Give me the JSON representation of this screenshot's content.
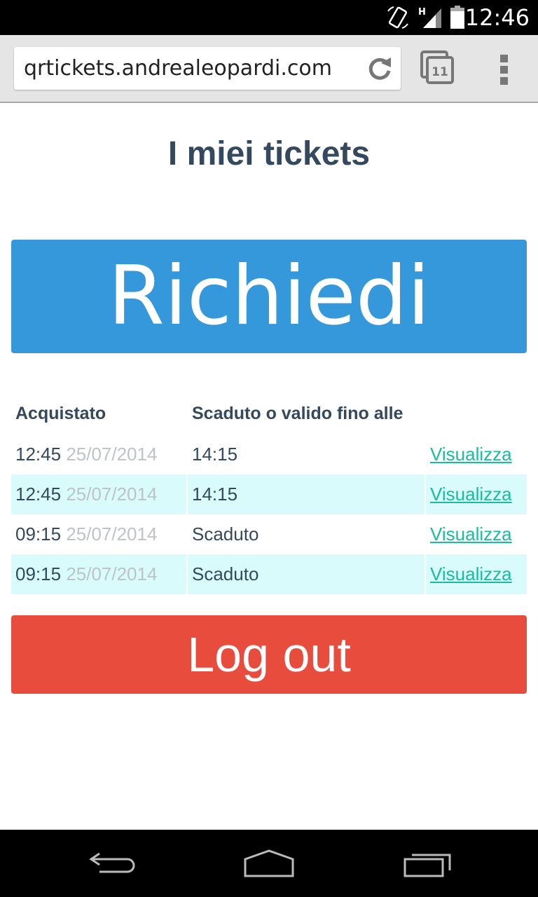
{
  "status_bar": {
    "time": "12:46",
    "icons": [
      "rotate-icon",
      "signal-h-icon",
      "battery-icon"
    ]
  },
  "browser": {
    "url": "qrtickets.andrealeopardi.com",
    "tab_count": "11",
    "icons": [
      "reload-icon",
      "tabs-icon",
      "overflow-menu-icon"
    ]
  },
  "page": {
    "title": "I miei tickets",
    "request_button": "Richiedi",
    "logout_button": "Log out"
  },
  "table": {
    "headers": [
      "Acquistato",
      "Scaduto o valido fino alle",
      ""
    ],
    "rows": [
      {
        "time": "12:45",
        "date": "25/07/2014",
        "status": "14:15",
        "link": "Visualizza"
      },
      {
        "time": "12:45",
        "date": "25/07/2014",
        "status": "14:15",
        "link": "Visualizza"
      },
      {
        "time": "09:15",
        "date": "25/07/2014",
        "status": "Scaduto",
        "link": "Visualizza"
      },
      {
        "time": "09:15",
        "date": "25/07/2014",
        "status": "Scaduto",
        "link": "Visualizza"
      }
    ]
  },
  "nav_bar": {
    "icons": [
      "back-icon",
      "home-icon",
      "recents-icon"
    ]
  },
  "colors": {
    "title": "#34495e",
    "request_button": "#3498db",
    "logout_button": "#e74c3c",
    "link": "#1abc9c",
    "stripe": "#d9fbfb"
  }
}
